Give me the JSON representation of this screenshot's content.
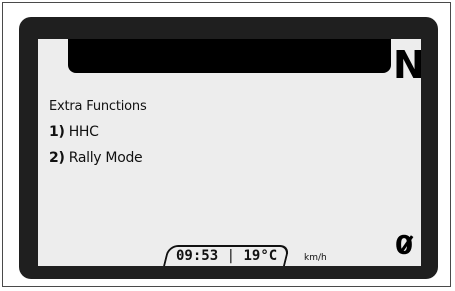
{
  "display": {
    "gear_indicator": "N",
    "menu": {
      "title": "Extra Functions",
      "items": [
        {
          "number": "1)",
          "label": "HHC"
        },
        {
          "number": "2)",
          "label": "Rally Mode"
        }
      ]
    },
    "status": {
      "time": "09:53",
      "separator": "|",
      "temperature": "19°C",
      "speed_unit": "km/h",
      "speed_value": "0"
    }
  },
  "colors": {
    "bezel": "#1f1f1f",
    "screen_background": "#ededed",
    "text": "#111111"
  }
}
